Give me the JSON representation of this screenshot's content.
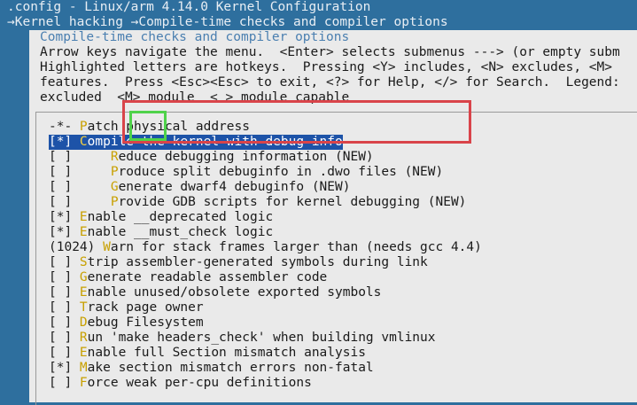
{
  "header": {
    "config_path": ".config - Linux/arm 4.14.0 Kernel Configuration",
    "breadcrumb": "→Kernel hacking →Compile-time checks and compiler options"
  },
  "dialog": {
    "title": "Compile-time checks and compiler options",
    "help_lines": [
      "Arrow keys navigate the menu.  <Enter> selects submenus ---> (or empty subm",
      "Highlighted letters are hotkeys.  Pressing <Y> includes, <N> excludes, <M>",
      "features.  Press <Esc><Esc> to exit, <?> for Help, </> for Search.  Legend:",
      "excluded  <M> module  < > module capable"
    ]
  },
  "menu": {
    "items": [
      {
        "prefix": "-*- ",
        "hotkey": "P",
        "rest": "atch physical address",
        "selected": false
      },
      {
        "prefix": "[*] ",
        "hotkey": "C",
        "rest": "ompile the kernel with debug info",
        "selected": true
      },
      {
        "prefix": "[ ]     ",
        "hotkey": "R",
        "rest": "educe debugging information (NEW)",
        "selected": false
      },
      {
        "prefix": "[ ]     ",
        "hotkey": "P",
        "rest": "roduce split debuginfo in .dwo files (NEW)",
        "selected": false
      },
      {
        "prefix": "[ ]     ",
        "hotkey": "G",
        "rest": "enerate dwarf4 debuginfo (NEW)",
        "selected": false
      },
      {
        "prefix": "[ ]     ",
        "hotkey": "P",
        "rest": "rovide GDB scripts for kernel debugging (NEW)",
        "selected": false
      },
      {
        "prefix": "[*] ",
        "hotkey": "E",
        "rest": "nable __deprecated logic",
        "selected": false
      },
      {
        "prefix": "[*] ",
        "hotkey": "E",
        "rest": "nable __must_check logic",
        "selected": false
      },
      {
        "prefix": "(1024) ",
        "hotkey": "W",
        "rest": "arn for stack frames larger than (needs gcc 4.4)",
        "selected": false
      },
      {
        "prefix": "[ ] ",
        "hotkey": "S",
        "rest": "trip assembler-generated symbols during link",
        "selected": false
      },
      {
        "prefix": "[ ] ",
        "hotkey": "G",
        "rest": "enerate readable assembler code",
        "selected": false
      },
      {
        "prefix": "[ ] ",
        "hotkey": "E",
        "rest": "nable unused/obsolete exported symbols",
        "selected": false
      },
      {
        "prefix": "[ ] ",
        "hotkey": "T",
        "rest": "rack page owner",
        "selected": false
      },
      {
        "prefix": "[ ] ",
        "hotkey": "D",
        "rest": "ebug Filesystem",
        "selected": false
      },
      {
        "prefix": "[ ] ",
        "hotkey": "R",
        "rest": "un 'make headers_check' when building vmlinux",
        "selected": false
      },
      {
        "prefix": "[ ] ",
        "hotkey": "E",
        "rest": "nable full Section mismatch analysis",
        "selected": false
      },
      {
        "prefix": "[*] ",
        "hotkey": "M",
        "rest": "ake section mismatch errors non-fatal",
        "selected": false
      },
      {
        "prefix": "[ ] ",
        "hotkey": "F",
        "rest": "orce weak per-cpu definitions",
        "selected": false
      }
    ]
  },
  "colors": {
    "background": "#2e6f9e",
    "dialog": "#eaeaea",
    "highlight": "#1d53a8",
    "hotkey": "#c8a000",
    "annotation_red": "#d9444a",
    "annotation_green": "#4fd24a"
  }
}
